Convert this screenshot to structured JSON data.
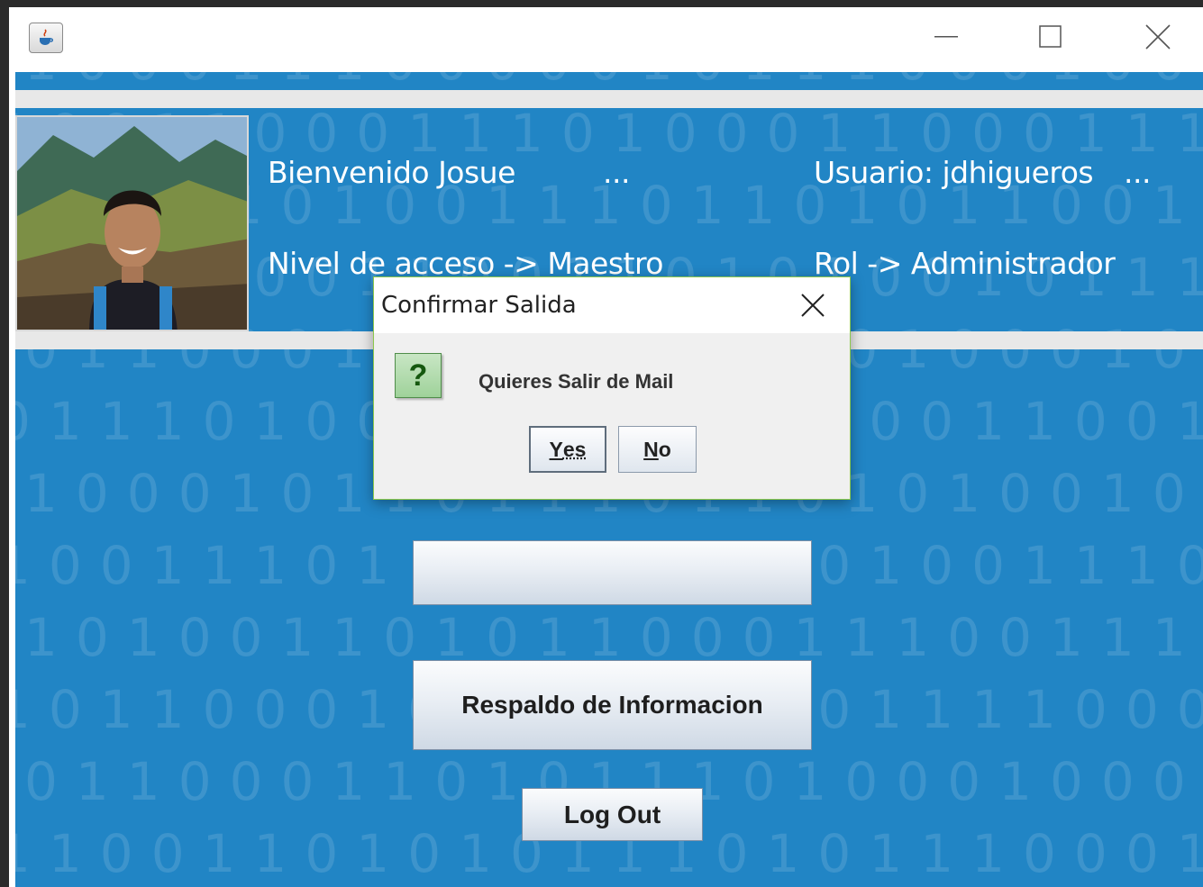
{
  "window": {
    "title": "",
    "minimize_icon": "minimize-icon",
    "maximize_icon": "maximize-icon",
    "close_icon": "close-icon"
  },
  "header": {
    "welcome": "Bienvenido Josue",
    "welcome_more": "...",
    "user": "Usuario: jdhigueros",
    "user_more": "...",
    "access_level": "Nivel de acceso -> Maestro",
    "role": "Rol -> Administrador"
  },
  "main": {
    "backup_button": "Respaldo de Informacion",
    "logout_button": "Log Out"
  },
  "dialog": {
    "title": "Confirmar Salida",
    "icon": "question-icon",
    "icon_glyph": "?",
    "message": "Quieres Salir de Mail",
    "yes_mnemonic": "Y",
    "yes_rest": "es",
    "no_mnemonic": "N",
    "no_rest": "o"
  },
  "colors": {
    "background_blue": "#2185c5",
    "dialog_border": "#8cc84b"
  }
}
